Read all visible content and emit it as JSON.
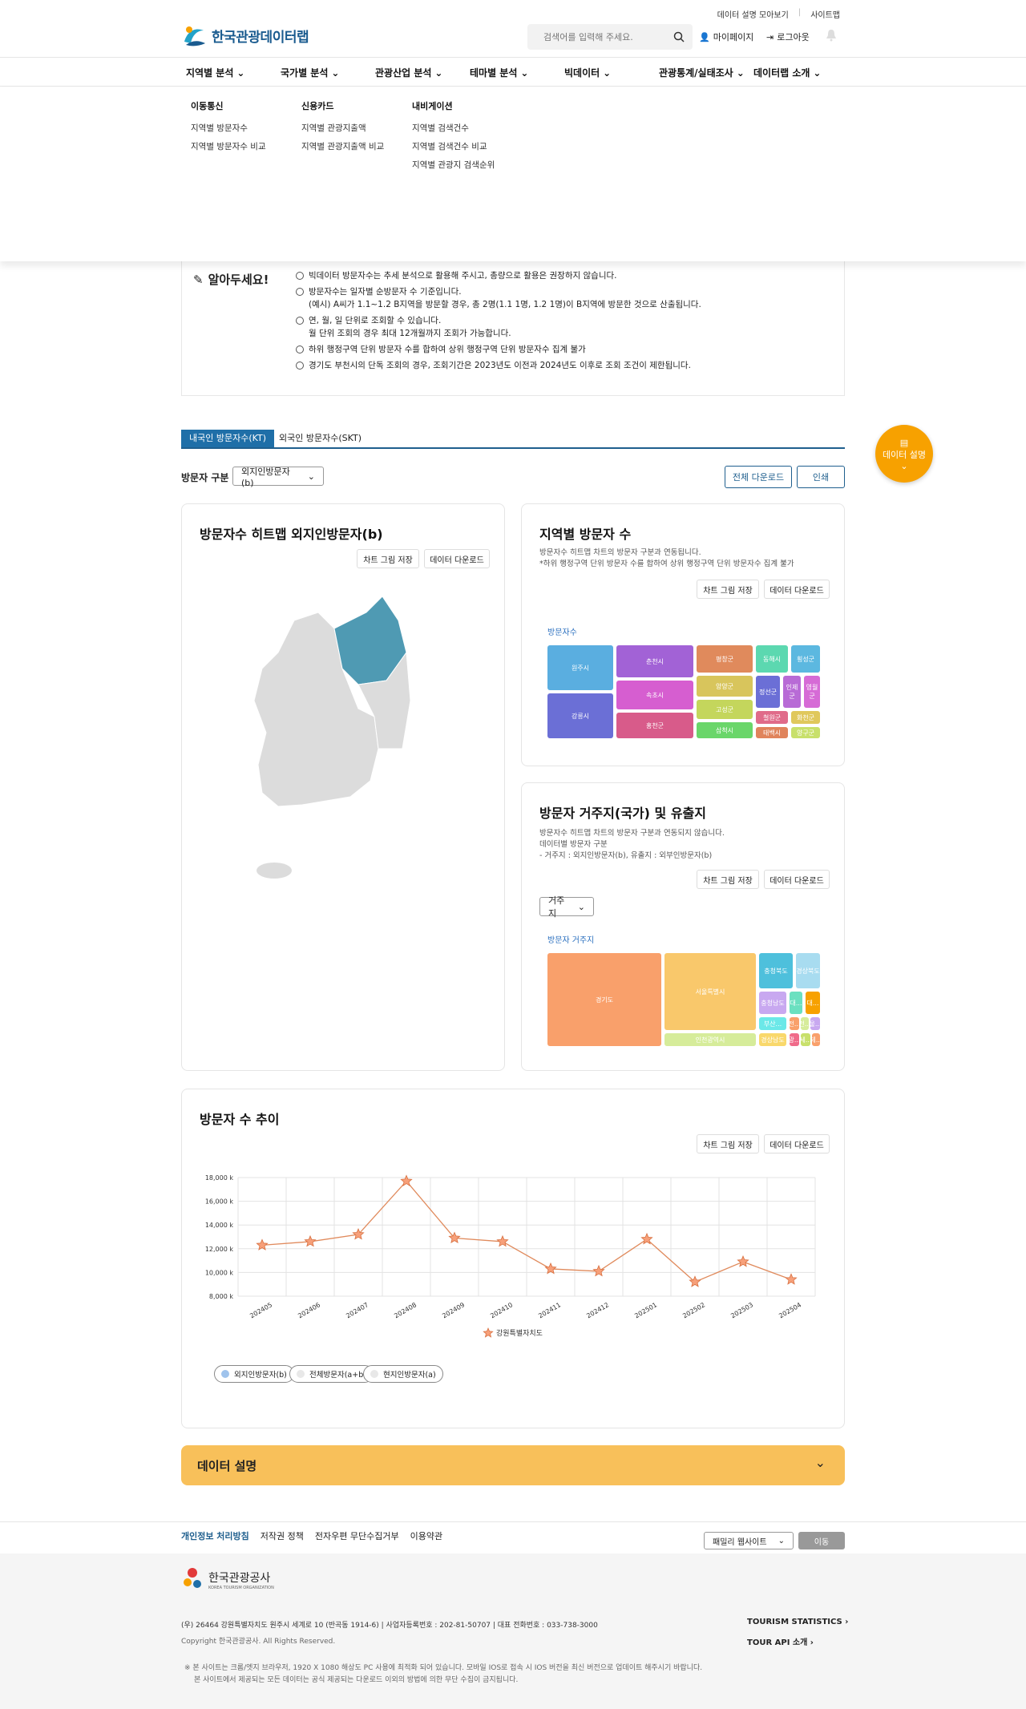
{
  "header": {
    "links": [
      "데이터 설명 모아보기",
      "사이트맵"
    ],
    "logo_text": "한국관광데이터랩",
    "search_placeholder": "검색어를 입력해 주세요.",
    "mypage": "마이페이지",
    "logout": "로그아웃"
  },
  "nav": [
    "지역별 분석",
    "국가별 분석",
    "관광산업 분석",
    "테마별 분석",
    "빅데이터",
    "관광통계/실태조사",
    "데이터랩 소개"
  ],
  "mega": [
    {
      "title": "이동통신",
      "items": [
        "지역별 방문자수",
        "지역별 방문자수 비교"
      ]
    },
    {
      "title": "신용카드",
      "items": [
        "지역별 관광지출액",
        "지역별 관광지출액 비교"
      ]
    },
    {
      "title": "내비게이션",
      "items": [
        "지역별 검색건수",
        "지역별 검색건수 비교",
        "지역별 관광지 검색순위"
      ]
    }
  ],
  "notice": {
    "title": "알아두세요!",
    "items": [
      "빅데이터 방문자수는 추세 분석으로 활용해 주시고, 총량으로 활용은 권장하지 않습니다.",
      "방문자수는 일자별 순방문자 수 기준입니다.",
      "(예시) A씨가 1.1~1.2 B지역을 방문할 경우, 총 2명(1.1 1명, 1.2 1명)이 B지역에 방문한 것으로 산출됩니다.",
      "연, 월, 일 단위로 조회할 수 있습니다.",
      "월 단위 조회의 경우 최대 12개월까지 조회가 가능합니다.",
      "하위 행정구역 단위 방문자 수를 합하여 상위 행정구역 단위 방문자수 집계 불가",
      "경기도 부천시의 단독 조회의 경우, 조회기간은 2023년도 이전과 2024년도 이후로 조회 조건이 제한됩니다."
    ]
  },
  "tabs": [
    "내국인 방문자수(KT)",
    "외국인 방문자수(SKT)"
  ],
  "filter": {
    "label": "방문자 구분",
    "value": "외지인방문자(b)",
    "download_all": "전체 다운로드",
    "print": "인쇄"
  },
  "fab": "데이터 설명",
  "buttons": {
    "save_chart": "차트 그림 저장",
    "download": "데이터 다운로드"
  },
  "heatmap": {
    "title": "방문자수 히트맵 외지인방문자(b)"
  },
  "region_card": {
    "title": "지역별 방문자 수",
    "desc1": "방문자수 히트맵 차트의 방문자 구분과 연동됩니다.",
    "desc2": "*하위 행정구역 단위 방문자 수를 합하여 상위 행정구역 단위 방문자수 집계 불가",
    "legend": "방문자수"
  },
  "origin_card": {
    "title": "방문자 거주지(국가) 및 유출지",
    "desc1": "방문자수 히트맵 차트의 방문자 구분과 연동되지 않습니다.",
    "desc2": "데이터별 방문자 구분",
    "desc3": "- 거주지 : 외지인방문자(b), 유출지 : 외부인방문자(b)",
    "select": "거주지",
    "legend": "방문자 거주지"
  },
  "trend": {
    "title": "방문자 수 추이",
    "pills": [
      "외지인방문자(b)",
      "전체방문자(a+b)",
      "현지인방문자(a)"
    ]
  },
  "chart_data": [
    {
      "type": "treemap",
      "legend": "방문자수",
      "categories": [
        "원주시",
        "강릉시",
        "춘천시",
        "속초시",
        "홍천군",
        "평창군",
        "양양군",
        "고성군",
        "삼척시",
        "동해시",
        "횡성군",
        "정선군",
        "인제군",
        "영월군",
        "철원군",
        "태백시",
        "화천군",
        "양구군"
      ],
      "colors": [
        "#5aaee0",
        "#6b6fd6",
        "#a262d6",
        "#d65ed0",
        "#d85b8a",
        "#e08a5c",
        "#d8c55c",
        "#c4d65c",
        "#6ad66a",
        "#5cd8b0",
        "#5cb8e0",
        "#6b6fd6",
        "#b86bd6",
        "#d66bd6",
        "#e06b8a",
        "#e0845c",
        "#e0c85c",
        "#c8e06b"
      ]
    },
    {
      "type": "treemap",
      "legend": "방문자 거주지",
      "categories": [
        "경기도",
        "서울특별시",
        "인천광역시",
        "충청북도",
        "경상북도",
        "충청남도",
        "대...",
        "대...",
        "부산...",
        "전...",
        "전...",
        "울...",
        "경상남도",
        "광...",
        "세...",
        "제..."
      ],
      "colors": [
        "#f9a06b",
        "#f9c86b",
        "#d6ec9a",
        "#4ec0dc",
        "#a8dcf0",
        "#c8a8f0",
        "#6be0c0",
        "#f7a100",
        "#6be8e8",
        "#f9a06b",
        "#d6ec9a",
        "#c8a8f0",
        "#f9d86b",
        "#f06b8a",
        "#c8e06b",
        "#f9a06b"
      ]
    },
    {
      "type": "line",
      "categories": [
        "202405",
        "202406",
        "202407",
        "202408",
        "202409",
        "202410",
        "202411",
        "202412",
        "202501",
        "202502",
        "202503",
        "202504"
      ],
      "series": [
        {
          "name": "강원특별자치도",
          "values": [
            12300,
            12600,
            13200,
            17700,
            12900,
            12600,
            10300,
            10100,
            12800,
            9200,
            10900,
            9400
          ]
        }
      ],
      "ylim": [
        8000,
        18000
      ],
      "yticks": [
        "8,000 k",
        "10,000 k",
        "12,000 k",
        "14,000 k",
        "16,000 k",
        "18,000 k"
      ],
      "color": "#e08a5c"
    }
  ],
  "footer": {
    "links": [
      "개인정보 처리방침",
      "저작권 정책",
      "전자우편 무단수집거부",
      "이용약관"
    ],
    "family": "패밀리 웹사이트",
    "go": "이동",
    "org": "한국관광공사",
    "org_en": "KOREA TOURISM ORGANIZATION",
    "address": "(우) 26464 강원특별자치도 원주시 세계로 10 (반곡동 1914-6)  |  사업자등록번호 : 202-81-50707  |  대표 전화번호 : 033-738-3000",
    "copyright": "Copyright 한국관광공사. All Rights Reserved.",
    "note1": "※ 본 사이트는 크롬/엣지 브라우저, 1920 X 1080 해상도 PC 사용에 최적화 되어 있습니다. 모바일 IOS로 접속 시 IOS 버전을 최신 버전으로 업데이트 해주시기 바랍니다.",
    "note2": "본 사이트에서 제공되는 모든 데이터는 공식 제공되는 다운로드 이외의 방법에 의한 무단 수집이 금지됩니다.",
    "ts": "TOURISM STATISTICS",
    "api": "TOUR API 소개"
  },
  "data_desc": "데이터 설명"
}
